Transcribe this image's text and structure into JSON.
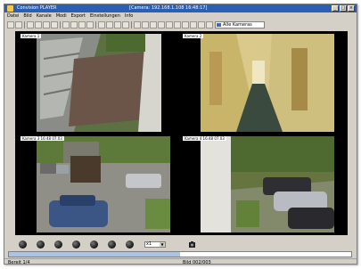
{
  "window": {
    "title": "Convision PLAYER",
    "title_extra": "[Camera: 192.168.1.108  16:48:17]"
  },
  "menu": [
    "Datei",
    "Bild",
    "Kanale",
    "Modi",
    "Export",
    "Einstellungen",
    "Info"
  ],
  "toolbar": {
    "camera_select": "Alle Kameras"
  },
  "cameras": [
    {
      "label": "Kamera 1"
    },
    {
      "label": "Kamera 2"
    },
    {
      "label": "Kamera 3  16:48  07.03"
    },
    {
      "label": "Kamera 4  16:48  07.03"
    }
  ],
  "playback": {
    "speed": "x1",
    "position_fraction": 0.5
  },
  "statusbar": {
    "left": "Bereit 1/4",
    "right": "Bild 002/003"
  },
  "colors": {
    "titlebar": "#2a5fb4",
    "window_bg": "#d4d0c8"
  }
}
